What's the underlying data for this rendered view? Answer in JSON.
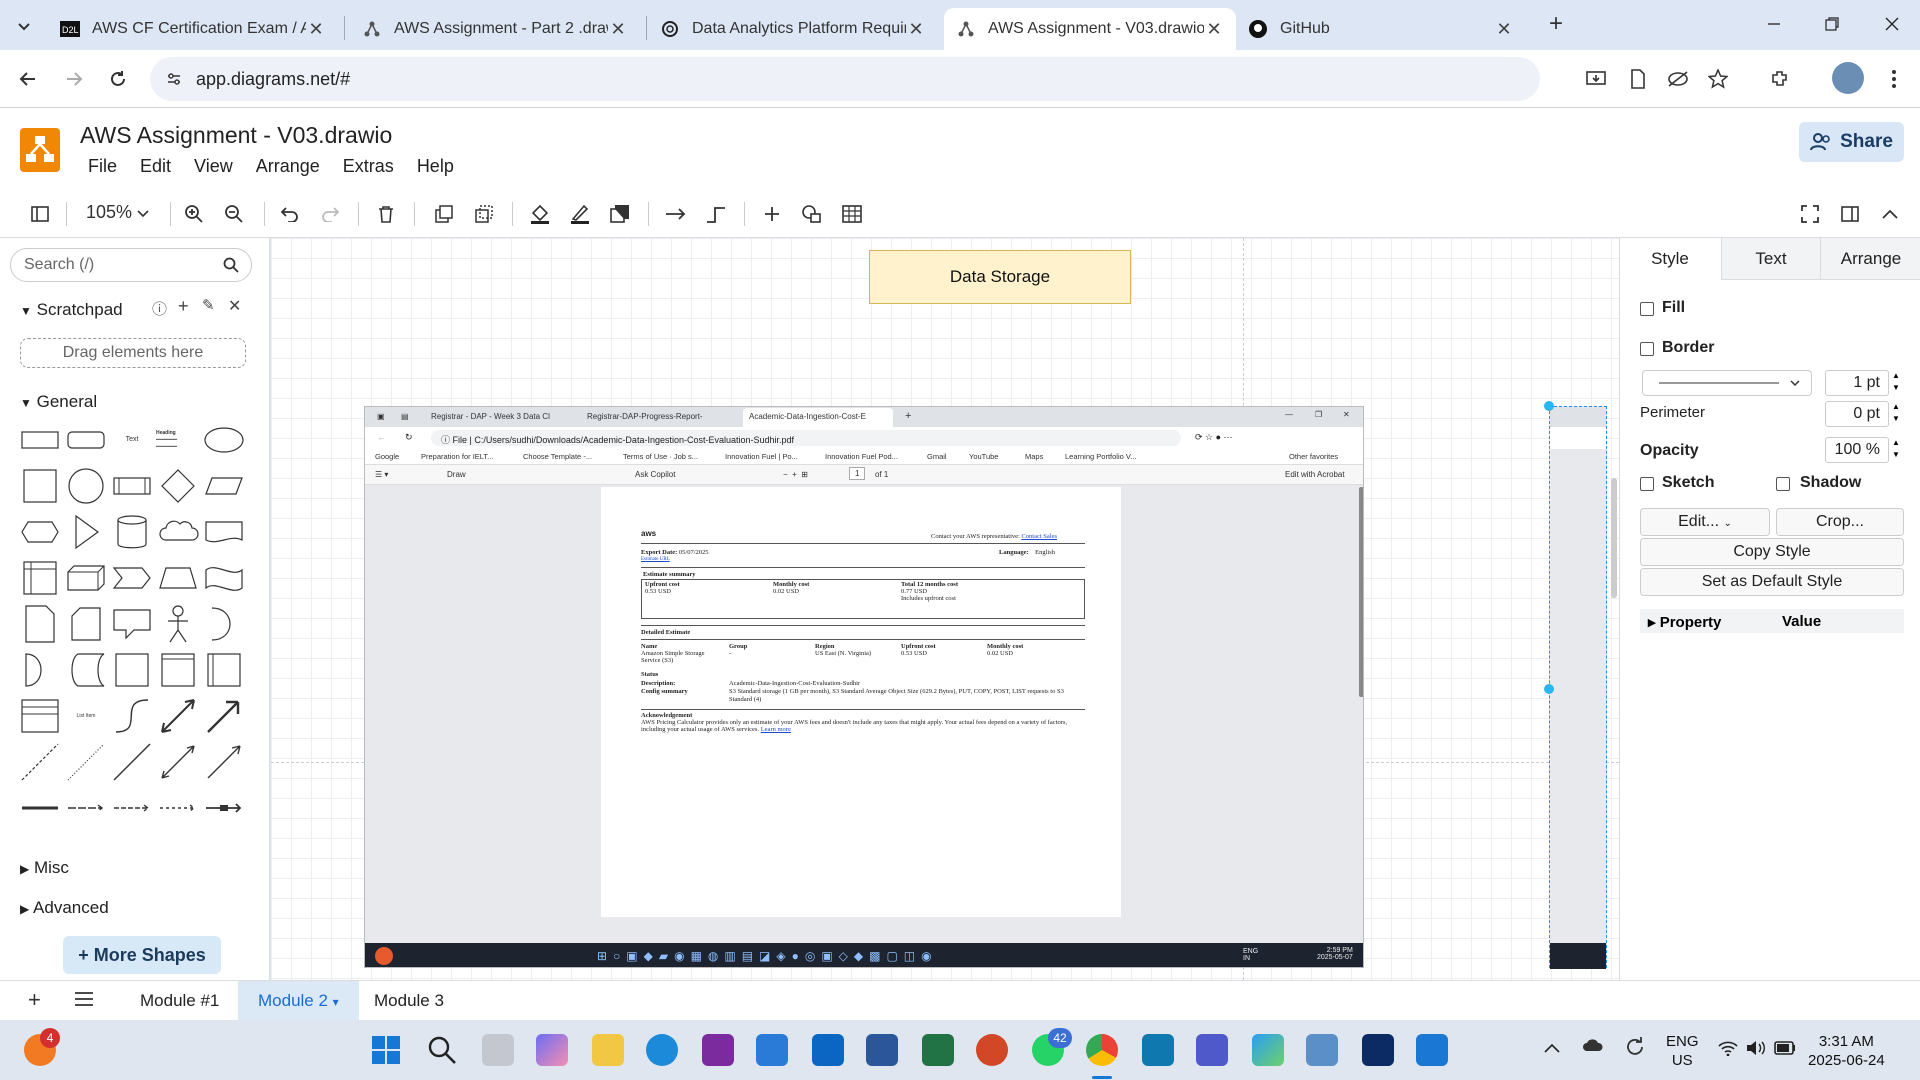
{
  "browser": {
    "tabs": [
      {
        "title": "AWS CF Certification Exam / AW",
        "icon": "d2l-icon"
      },
      {
        "title": "AWS Assignment - Part 2 .drawi",
        "icon": "drawio-icon"
      },
      {
        "title": "Data Analytics Platform Require",
        "icon": "chatgpt-icon"
      },
      {
        "title": "AWS Assignment - V03.drawio",
        "icon": "drawio-icon"
      },
      {
        "title": "GitHub",
        "icon": "github-icon"
      }
    ],
    "url": "app.diagrams.net/#"
  },
  "app": {
    "title": "AWS Assignment - V03.drawio",
    "menu": [
      "File",
      "Edit",
      "View",
      "Arrange",
      "Extras",
      "Help"
    ],
    "share_label": "Share",
    "zoom": "105%"
  },
  "left_panel": {
    "search_placeholder": "Search (/)",
    "scratchpad_label": "Scratchpad",
    "drag_hint": "Drag elements here",
    "general_label": "General",
    "misc_label": "Misc",
    "advanced_label": "Advanced",
    "more_shapes_label": "+ More Shapes",
    "shape_text_label": "Text",
    "shape_heading_label": "Heading",
    "shape_list_label": "List Item"
  },
  "canvas": {
    "data_storage_label": "Data Storage",
    "screenshot": {
      "tabs": [
        "Registrar - DAP - Week 3 Data Cl",
        "Registrar-DAP-Progress-Report-",
        "Academic-Data-Ingestion-Cost-E"
      ],
      "file_label": "File",
      "path": "C:/Users/sudhi/Downloads/Academic-Data-Ingestion-Cost-Evaluation-Sudhir.pdf",
      "favorites": [
        "Google",
        "Preparation for IELT...",
        "Choose Template -...",
        "Terms of Use · Job s...",
        "Innovation Fuel | Po...",
        "Innovation Fuel Pod...",
        "Gmail",
        "YouTube",
        "Maps",
        "Learning Portfolio V..."
      ],
      "other_favorites": "Other favorites",
      "pdf_tools": {
        "draw": "Draw",
        "copilot": "Ask Copilot",
        "page": "1",
        "of": "of 1",
        "acrobat": "Edit with Acrobat"
      },
      "pdf": {
        "logo": "aws",
        "contact": "Contact your AWS representative:",
        "contact_link": "Contact Sales",
        "export_date_label": "Export Date:",
        "export_date": "05/07/2025",
        "estimate_url": "Estimate URL",
        "language_label": "Language:",
        "language": "English",
        "summary_title": "Estimate summary",
        "upfront_label": "Upfront cost",
        "upfront": "0.53 USD",
        "monthly_label": "Monthly cost",
        "monthly": "0.02 USD",
        "total_label": "Total 12 months cost",
        "total": "0.77 USD",
        "total_note": "Includes upfront cost",
        "detailed_title": "Detailed Estimate",
        "columns": [
          "Name",
          "Group",
          "Region",
          "Upfront cost",
          "Monthly cost"
        ],
        "row": [
          "Amazon Simple Storage Service (S3)",
          "-",
          "US East (N. Virginia)",
          "0.53 USD",
          "0.02 USD"
        ],
        "status_label": "Status",
        "description_label": "Description:",
        "description": "Academic-Data-Ingestion-Cost-Evaluation-Sudhir",
        "config_label": "Config summary",
        "config": "S3 Standard storage (1 GB per month), S3 Standard Average Object Size (629.2 Bytes), PUT, COPY, POST, LIST requests to S3 Standard (4)",
        "ack_title": "Acknowledgement",
        "ack": "AWS Pricing Calculator provides only an estimate of your AWS fees and doesn't include any taxes that might apply. Your actual fees depend on a variety of factors, including your actual usage of AWS services.",
        "learn_more": "Learn more"
      },
      "taskbar_time": "2:59 PM",
      "taskbar_date": "2025-05-07",
      "taskbar_lang": "ENG",
      "taskbar_region": "IN"
    }
  },
  "right_panel": {
    "tabs": [
      "Style",
      "Text",
      "Arrange"
    ],
    "fill_label": "Fill",
    "border_label": "Border",
    "border_width": "1 pt",
    "perimeter_label": "Perimeter",
    "perimeter": "0 pt",
    "opacity_label": "Opacity",
    "opacity": "100 %",
    "sketch_label": "Sketch",
    "shadow_label": "Shadow",
    "edit_label": "Edit...",
    "crop_label": "Crop...",
    "copy_style_label": "Copy Style",
    "default_style_label": "Set as Default Style",
    "property_label": "Property",
    "value_label": "Value"
  },
  "pages": [
    "Module #1",
    "Module 2",
    "Module 3"
  ],
  "taskbar": {
    "badge_firefox": "4",
    "badge_whatsapp": "42",
    "lang": "ENG",
    "region": "US",
    "time": "3:31 AM",
    "date": "2025-06-24"
  },
  "colors": {
    "accent": "#1a73e8",
    "drawio_orange": "#f08705",
    "storage_fill": "#fff2cc",
    "storage_stroke": "#d6b656"
  }
}
